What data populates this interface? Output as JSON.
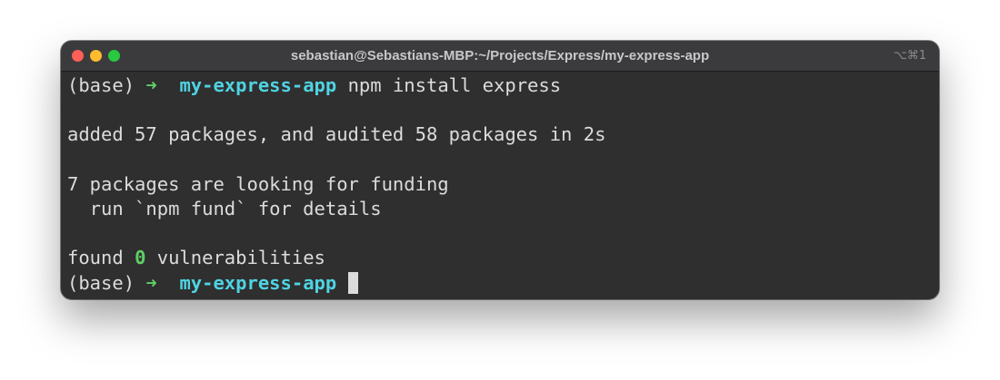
{
  "window": {
    "title": "sebastian@Sebastians-MBP:~/Projects/Express/my-express-app",
    "shortcut": "⌥⌘1"
  },
  "terminal": {
    "prompt_env": "(base)",
    "prompt_arrow": "➜",
    "prompt_dir": "my-express-app",
    "command": "npm install express",
    "added_line": "added 57 packages, and audited 58 packages in 2s",
    "funding_line": "7 packages are looking for funding",
    "fund_hint": "  run `npm fund` for details",
    "found_prefix": "found",
    "vuln_count": "0",
    "found_suffix": "vulnerabilities"
  },
  "colors": {
    "background": "#2f2f2f",
    "titlebar": "#3b3b3d",
    "text": "#dcdcdc",
    "prompt_arrow": "#5fcf65",
    "prompt_dir": "#4fd3e2",
    "close_button": "#fe5f57",
    "minimize_button": "#febc2e",
    "maximize_button": "#28c840"
  },
  "icons": {
    "close": "close-icon",
    "minimize": "minimize-icon",
    "maximize": "maximize-icon"
  }
}
